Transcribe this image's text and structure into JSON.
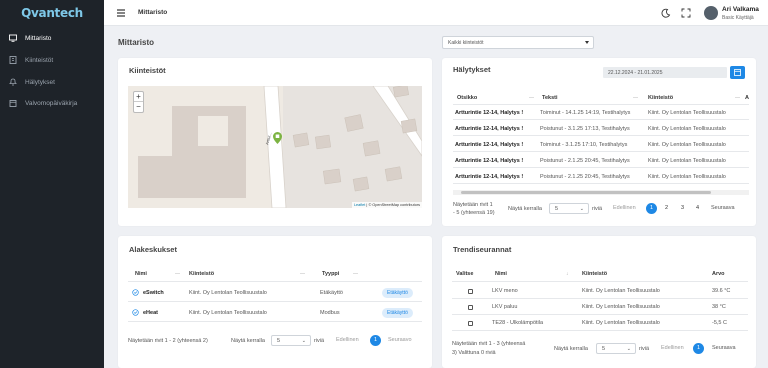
{
  "app": {
    "brand": "Qvantech"
  },
  "sidebar": {
    "items": [
      {
        "label": "Mittaristo",
        "icon": "monitor-icon",
        "active": true
      },
      {
        "label": "Kiinteistöt",
        "icon": "building-icon",
        "active": false
      },
      {
        "label": "Hälytykset",
        "icon": "bell-icon",
        "active": false
      },
      {
        "label": "Valvomopäiväkirja",
        "icon": "calendar-icon",
        "active": false
      }
    ]
  },
  "topbar": {
    "title": "Mittaristo",
    "user_name": "Ari Valkama",
    "user_role": "Basic Käyttäjä"
  },
  "page": {
    "title": "Mittaristo",
    "property_select": "Kaikki kiinteistöt"
  },
  "properties_card": {
    "title": "Kiinteistöt",
    "map": {
      "zoom_in": "+",
      "zoom_out": "−",
      "street_label": "Arttur...",
      "attribution_leaflet": "Leaflet",
      "attribution_rest": " | © OpenStreetMap contributors"
    }
  },
  "alarms_card": {
    "title": "Hälytykset",
    "date_range": "22.12.2024 - 21.01.2025",
    "columns": [
      "Otsikko",
      "Teksti",
      "Kiinteistö",
      "A"
    ],
    "rows": [
      {
        "title": "Artturintie 12-14, Halytys !",
        "text": "Toiminut - 14.1.25 14:19, Testihalytys",
        "property": "Kiint. Oy Lentolan Teollisuustalo"
      },
      {
        "title": "Artturintie 12-14, Halytys !",
        "text": "Poistunut - 3.1.25 17:13, Testihalytys",
        "property": "Kiint. Oy Lentolan Teollisuustalo"
      },
      {
        "title": "Artturintie 12-14, Halytys !",
        "text": "Toiminut - 3.1.25 17:10, Testihalytys",
        "property": "Kiint. Oy Lentolan Teollisuustalo"
      },
      {
        "title": "Artturintie 12-14, Halytys !",
        "text": "Poistunut - 2.1.25 20:45, Testihalytys",
        "property": "Kiint. Oy Lentolan Teollisuustalo"
      },
      {
        "title": "Artturintie 12-14, Halytys !",
        "text": "Poistunut - 2.1.25 20:45, Testihalytys",
        "property": "Kiint. Oy Lentolan Teollisuustalo"
      }
    ],
    "footer": {
      "showing_line1": "Näytetään rivit 1",
      "showing_line2": "- 5 (yhteensä 19)",
      "per_page_label": "Näytä kerralla",
      "per_page_value": "5",
      "rows_label": "riviä",
      "prev": "Edellinen",
      "pages": [
        "1",
        "2",
        "3",
        "4"
      ],
      "next": "Seuraava"
    }
  },
  "submeters_card": {
    "title": "Alakeskukset",
    "columns": [
      "Nimi",
      "Kiinteistö",
      "Tyyppi"
    ],
    "rows": [
      {
        "name": "eSwitch",
        "property": "Kiint. Oy Lentolan Teollisuustalo",
        "type": "Etäkäyttö",
        "action": "Etäkäyttö"
      },
      {
        "name": "eHeat",
        "property": "Kiint. Oy Lentolan Teollisuustalo",
        "type": "Modbus",
        "action": "Etäkäyttö"
      }
    ],
    "footer": {
      "showing": "Näytetään rivit 1 - 2 (yhteensä 2)",
      "per_page_label": "Näytä kerralla",
      "per_page_value": "5",
      "rows_label": "riviä",
      "prev": "Edellinen",
      "page": "1",
      "next": "Seuraavo"
    }
  },
  "trends_card": {
    "title": "Trendiseurannat",
    "columns": [
      "Valitse",
      "Nimi",
      "Kiinteistö",
      "Arvo"
    ],
    "rows": [
      {
        "name": "LKV meno",
        "property": "Kiint. Oy Lentolan Teollisuustalo",
        "value": "39.6 °C"
      },
      {
        "name": "LKV paluu",
        "property": "Kiint. Oy Lentolan Teollisuustalo",
        "value": "38 °C"
      },
      {
        "name": "TE28 - Ulkolämpötila",
        "property": "Kiint. Oy Lentolan Teollisuustalo",
        "value": "-5,5 C"
      }
    ],
    "footer": {
      "showing_line1": "Näytetään rivit 1 - 3 (yhteensä",
      "showing_line2": "3)   Valittuna 0 riviä",
      "per_page_label": "Näytä kerralla",
      "per_page_value": "5",
      "rows_label": "riviä",
      "prev": "Edellinen",
      "page": "1",
      "next": "Seuraava"
    }
  },
  "colors": {
    "accent": "#1e88e5",
    "sidebar": "#1e2329",
    "brand": "#7ec8e8"
  }
}
